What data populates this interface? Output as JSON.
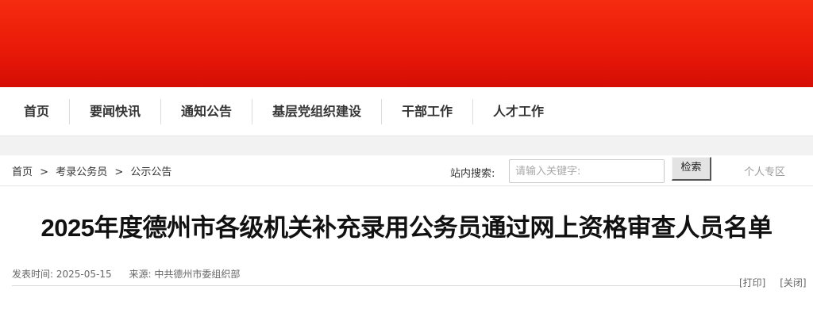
{
  "nav": {
    "items": [
      {
        "label": "首页"
      },
      {
        "label": "要闻快讯"
      },
      {
        "label": "通知公告"
      },
      {
        "label": "基层党组织建设"
      },
      {
        "label": "干部工作"
      },
      {
        "label": "人才工作"
      }
    ]
  },
  "breadcrumb": {
    "home": "首页",
    "sep1": ">",
    "level1": "考录公务员",
    "sep2": ">",
    "level2": "公示公告"
  },
  "search": {
    "label": "站内搜索:",
    "placeholder": "请输入关键字:",
    "button_label": "检索"
  },
  "personal_link": "个人专区",
  "article": {
    "title": "2025年度德州市各级机关补充录用公务员通过网上资格审查人员名单",
    "publish_label": "发表时间:",
    "publish_date": "2025-05-15",
    "source_label": "来源:",
    "source": "中共德州市委组织部",
    "print_label": "[打印]",
    "close_label": "[关闭]"
  },
  "colors": {
    "banner_top": "#f52c10",
    "banner_bottom": "#d50d06"
  }
}
